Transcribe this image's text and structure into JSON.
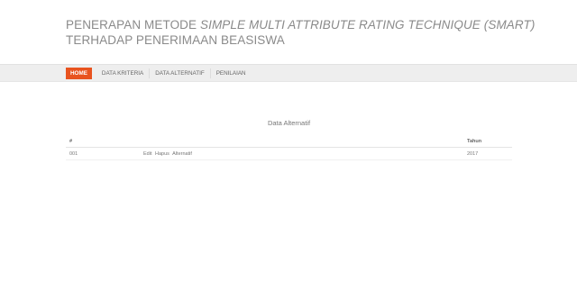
{
  "header": {
    "title_prefix": "PENERAPAN METODE ",
    "title_emphasis": "SIMPLE MULTI ATTRIBUTE RATING TECHNIQUE (SMART)",
    "title_line2": "TERHADAP PENERIMAAN BEASISWA"
  },
  "nav": {
    "items": [
      {
        "label": "HOME",
        "active": true
      },
      {
        "label": "DATA KRITERIA",
        "active": false
      },
      {
        "label": "DATA ALTERNATIF",
        "active": false
      },
      {
        "label": "PENILAIAN",
        "active": false
      }
    ],
    "accent_color": "#e8531f"
  },
  "table": {
    "caption": "Data Alternatif",
    "columns": [
      "#",
      "Tahun"
    ],
    "rows": [
      {
        "no": "001",
        "actions": [
          "Edit",
          "Hapus",
          "Alternatif"
        ],
        "year": "2017"
      }
    ]
  }
}
